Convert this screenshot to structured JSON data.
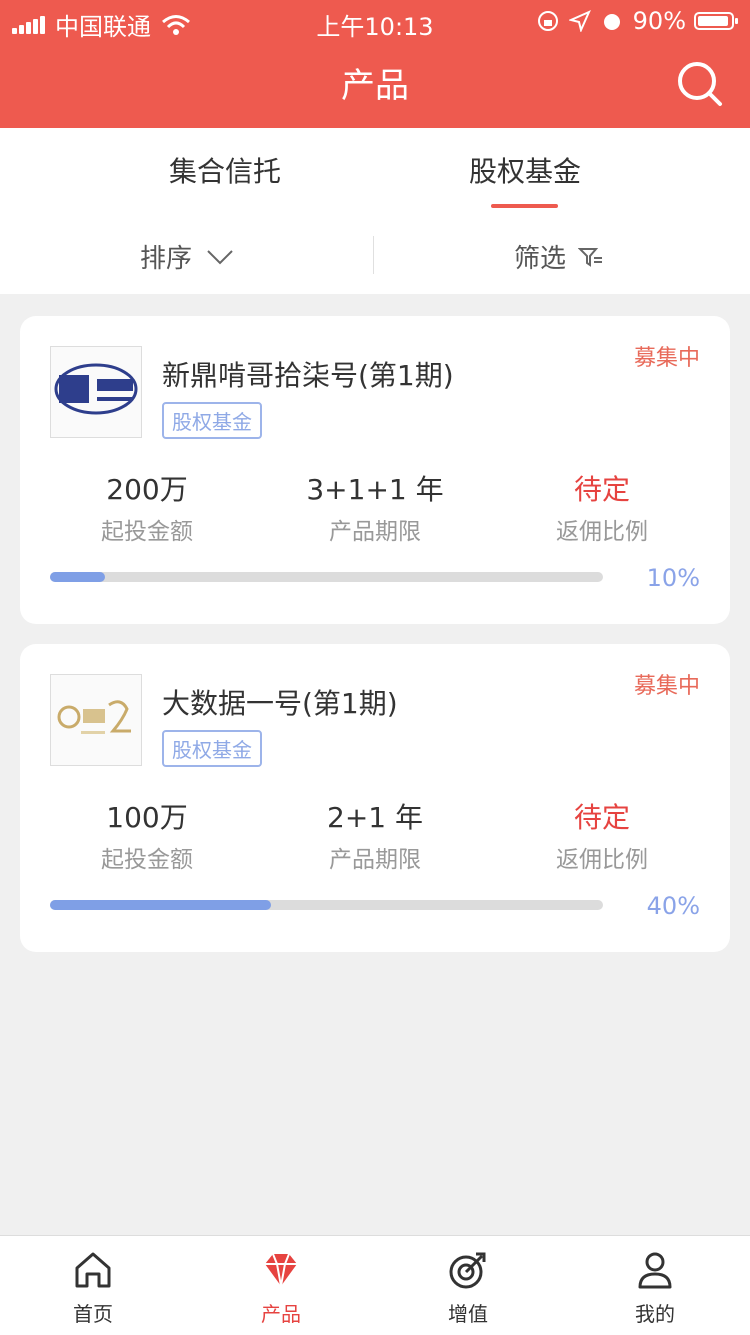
{
  "status_bar": {
    "carrier": "中国联通",
    "time": "上午10:13",
    "battery": "90%"
  },
  "header": {
    "title": "产品"
  },
  "tabs": [
    {
      "label": "集合信托"
    },
    {
      "label": "股权基金"
    }
  ],
  "filters": {
    "sort": "排序",
    "screen": "筛选"
  },
  "products": [
    {
      "name": "新鼎啃哥拾柒号(第1期)",
      "tag": "股权基金",
      "status": "募集中",
      "min_amount": "200万",
      "min_amount_label": "起投金额",
      "term": "3+1+1 年",
      "term_label": "产品期限",
      "commission": "待定",
      "commission_label": "返佣比例",
      "progress_text": "10%",
      "progress": 0.1
    },
    {
      "name": "大数据一号(第1期)",
      "tag": "股权基金",
      "status": "募集中",
      "min_amount": "100万",
      "min_amount_label": "起投金额",
      "term": "2+1 年",
      "term_label": "产品期限",
      "commission": "待定",
      "commission_label": "返佣比例",
      "progress_text": "40%",
      "progress": 0.4
    }
  ],
  "bottom_nav": [
    {
      "label": "首页",
      "icon": "home-icon"
    },
    {
      "label": "产品",
      "icon": "diamond-icon"
    },
    {
      "label": "增值",
      "icon": "target-icon"
    },
    {
      "label": "我的",
      "icon": "user-icon"
    }
  ],
  "colors": {
    "brand": "#ee5a4f",
    "accent": "#7f9fe6",
    "alert": "#e64340"
  }
}
